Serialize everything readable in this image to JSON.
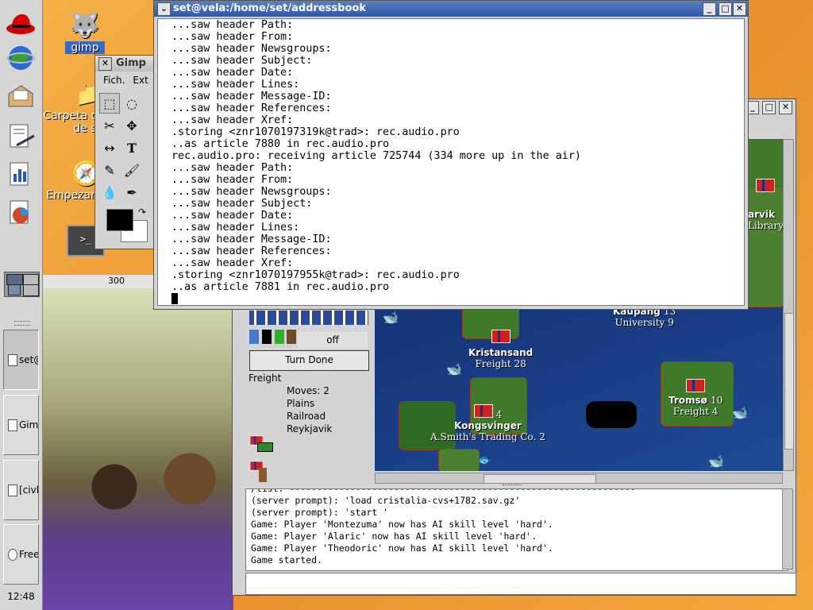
{
  "panel": {
    "tasks": [
      {
        "label": "set@"
      },
      {
        "label": "Gim"
      },
      {
        "label": "[civl"
      },
      {
        "label": "Free"
      }
    ],
    "clock": "12:48"
  },
  "desktop": {
    "icons": [
      {
        "label": "gimp"
      },
      {
        "label": "Carpeta d"
      },
      {
        "label": "de s"
      },
      {
        "label": "Empezar"
      }
    ],
    "ruler_mark": "300"
  },
  "terminal": {
    "title": "set@vela:/home/set/addressbook",
    "lines": [
      "...saw header Path:",
      "...saw header From:",
      "...saw header Newsgroups:",
      "...saw header Subject:",
      "...saw header Date:",
      "...saw header Lines:",
      "...saw header Message-ID:",
      "...saw header References:",
      "...saw header Xref:",
      ".storing <znr1070197319k@trad>: rec.audio.pro",
      "..as article 7880 in rec.audio.pro",
      "rec.audio.pro: receiving article 725744 (334 more up in the air)",
      "...saw header Path:",
      "...saw header From:",
      "...saw header Newsgroups:",
      "...saw header Subject:",
      "...saw header Date:",
      "...saw header Lines:",
      "...saw header Message-ID:",
      "...saw header References:",
      "...saw header Xref:",
      ".storing <znr1070197955k@trad>: rec.audio.pro",
      "..as article 7881 in rec.audio.pro"
    ]
  },
  "gimp": {
    "title": "Gimp",
    "menu": [
      "Fich.",
      "Ext"
    ]
  },
  "freeciv": {
    "status_off": "off",
    "turn_done": "Turn Done",
    "unit": {
      "name": "Freight",
      "moves": "Moves: 2",
      "terrain": "Plains",
      "improvement": "Railroad",
      "city": "Reykjavik"
    },
    "cities": [
      {
        "name": "Kristansand",
        "sub": "Freight 28"
      },
      {
        "name": "Kaupang",
        "size": "13",
        "sub": "University 9"
      },
      {
        "name": "Kongsvinger",
        "size": "4",
        "sub": "A.Smith's Trading Co. 2"
      },
      {
        "name": "Tromsø",
        "size": "10",
        "sub": "Freight 4"
      },
      {
        "name": "arvik",
        "sub": "Library"
      }
    ],
    "log": [
      "/list: ---------------------------------------------------------------",
      "(server prompt): 'load cristalia-cvs+1782.sav.gz'",
      "(server prompt): 'start '",
      "Game: Player 'Montezuma' now has AI skill level 'hard'.",
      "Game: Player 'Alaric' now has AI skill level 'hard'.",
      "Game: Player 'Theodoric' now has AI skill level 'hard'.",
      "Game started."
    ]
  }
}
